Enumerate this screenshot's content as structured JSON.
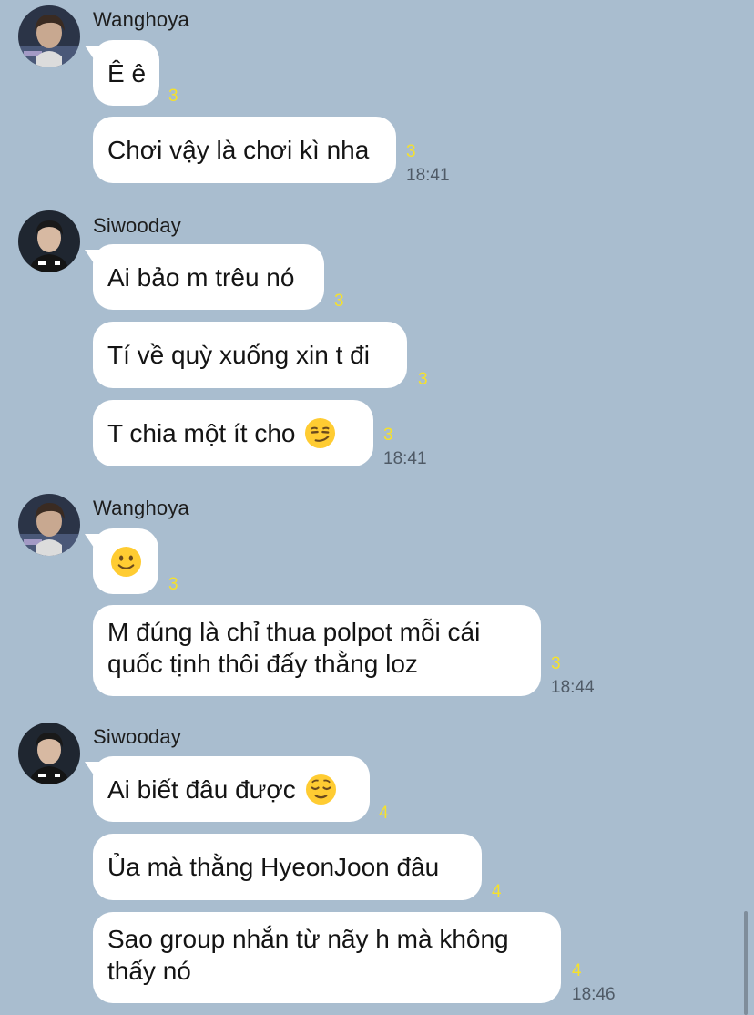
{
  "colors": {
    "background": "#a9bdcf",
    "bubble": "#ffffff",
    "unread_count": "#f6e12b",
    "timestamp": "#4f5a66"
  },
  "groups": [
    {
      "sender": "Wanghoya",
      "avatar": "wanghoya-avatar",
      "messages": [
        {
          "text": "Ê ê",
          "unread": "3"
        },
        {
          "text": "Chơi vậy là chơi kì nha",
          "unread": "3",
          "time": "18:41"
        }
      ]
    },
    {
      "sender": "Siwooday",
      "avatar": "siwooday-avatar",
      "messages": [
        {
          "text": "Ai bảo m trêu nó",
          "unread": "3"
        },
        {
          "text": "Tí về quỳ xuống xin t đi",
          "unread": "3"
        },
        {
          "text": "T chia một ít cho",
          "emoji": "smirk-emoji",
          "unread": "3",
          "time": "18:41"
        }
      ]
    },
    {
      "sender": "Wanghoya",
      "avatar": "wanghoya-avatar",
      "messages": [
        {
          "emoji": "slight-smile-emoji",
          "unread": "3"
        },
        {
          "text": "M đúng là chỉ thua polpot mỗi cái quốc tịnh thôi đấy thằng loz",
          "unread": "3",
          "time": "18:44"
        }
      ]
    },
    {
      "sender": "Siwooday",
      "avatar": "siwooday-avatar",
      "messages": [
        {
          "text": "Ai biết đâu được",
          "emoji": "relieved-emoji",
          "unread": "4"
        },
        {
          "text": "Ủa mà thằng HyeonJoon đâu",
          "unread": "4"
        },
        {
          "text": "Sao group nhắn từ nãy h mà không thấy nó",
          "unread": "4",
          "time": "18:46"
        }
      ]
    }
  ]
}
